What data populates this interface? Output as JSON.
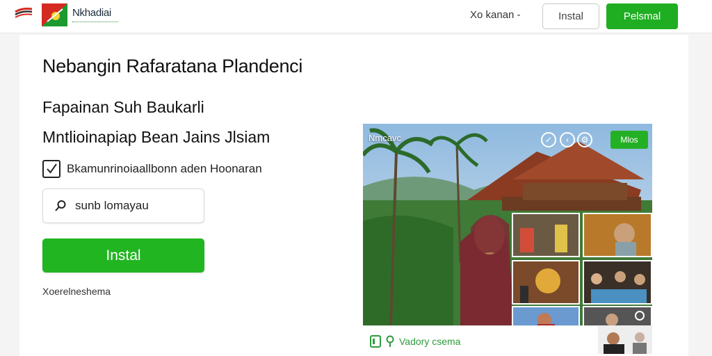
{
  "header": {
    "brand_name": "Nkhadiai",
    "link_label": "Xo kanan -",
    "outline_button": "Instal",
    "primary_button": "Pelsmal"
  },
  "main": {
    "title": "Nebangin Rafaratana Plandenci",
    "subtitle_1": "Fapainan Suh Baukarli",
    "subtitle_2": "Mntlioinapiap Bean Jains Jlsiam",
    "checkbox": {
      "label": "Bkamunrinoiaallbonn aden Hoonaran",
      "checked": true
    },
    "search": {
      "placeholder": "sunb lomayau"
    },
    "install_button": "Instal",
    "footnote": "Xoerelneshema"
  },
  "media": {
    "label": "Nmcavc",
    "badge": "Mlos",
    "caption": "Vadory csema",
    "controls": [
      "check-icon",
      "back-icon",
      "settings-icon"
    ]
  },
  "colors": {
    "accent_green": "#22b522",
    "caption_green": "#2e9b3c",
    "brand_red": "#d42a22"
  }
}
